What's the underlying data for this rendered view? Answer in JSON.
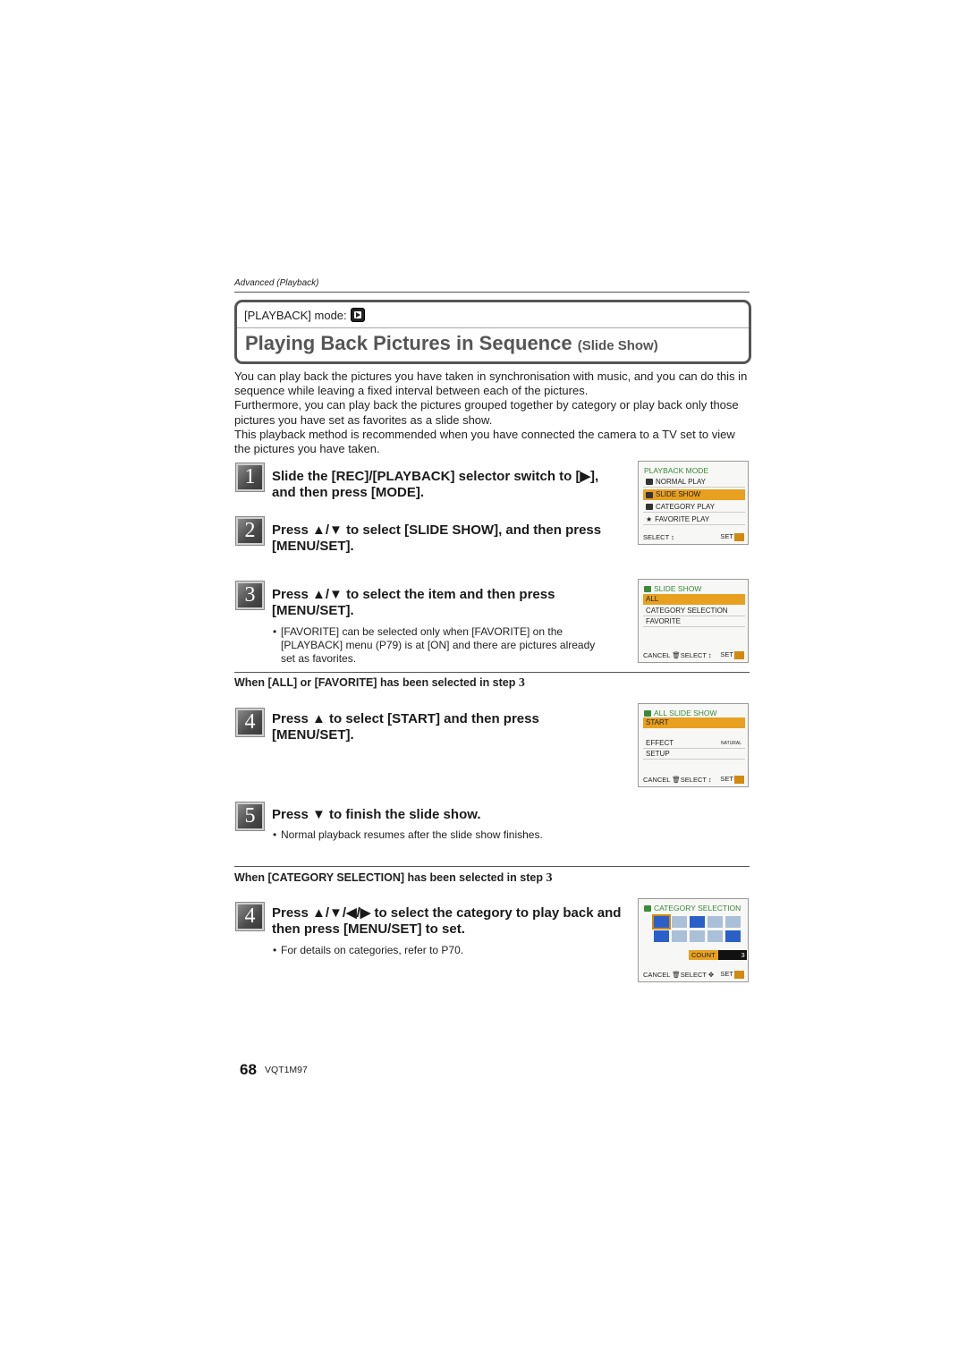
{
  "header": {
    "section_label": "Advanced (Playback)",
    "mode_label": "[PLAYBACK] mode:",
    "mode_icon": "playback-mode-icon",
    "title": "Playing Back Pictures in Sequence",
    "title_sub": "(Slide Show)"
  },
  "intro": [
    "You can play back the pictures you have taken in synchronisation with music, and you can do this in sequence while leaving a fixed interval between each of the pictures.",
    "Furthermore, you can play back the pictures grouped together by category or play back only those pictures you have set as favorites as a slide show.",
    "This playback method is recommended when you have connected the camera to a TV set to view the pictures you have taken."
  ],
  "steps": [
    {
      "number": "1",
      "text": "Slide the [REC]/[PLAYBACK] selector switch to [▶], and then press [MODE]."
    },
    {
      "number": "2",
      "text": "Press ▲/▼ to select [SLIDE SHOW], and then press [MENU/SET]."
    },
    {
      "number": "3",
      "text": "Press ▲/▼ to select the item and then press [MENU/SET].",
      "bullet": "[FAVORITE] can be selected only when [FAVORITE] on the [PLAYBACK] menu (P79) is at [ON] and there are pictures already set as favorites."
    }
  ],
  "section_all": {
    "heading": "When [ALL] or [FAVORITE] has been selected in step",
    "heading_num": "3",
    "steps": [
      {
        "number": "4",
        "text": "Press ▲ to select [START] and then press [MENU/SET]."
      },
      {
        "number": "5",
        "text": "Press ▼ to finish the slide show.",
        "bullet": "Normal playback resumes after the slide show finishes."
      }
    ]
  },
  "section_category": {
    "heading": "When [CATEGORY SELECTION] has been selected in step",
    "heading_num": "3",
    "steps": [
      {
        "number": "4",
        "text": "Press ▲/▼/◀/▶ to select the category to play back and then press [MENU/SET] to set.",
        "bullet": "For details on categories, refer to P70."
      }
    ]
  },
  "screens": {
    "playback_mode": {
      "title": "PLAYBACK MODE",
      "items": [
        "NORMAL PLAY",
        "SLIDE SHOW",
        "CATEGORY PLAY",
        "FAVORITE PLAY"
      ],
      "selected": "SLIDE SHOW",
      "footer_left": "SELECT ↕",
      "footer_right": "SET"
    },
    "slide_show": {
      "title": "SLIDE SHOW",
      "items": [
        "ALL",
        "CATEGORY SELECTION",
        "FAVORITE"
      ],
      "selected": "ALL",
      "footer_left": "CANCEL",
      "footer_mid": "SELECT ↕",
      "footer_right": "SET"
    },
    "all_slide_show": {
      "title": "ALL SLIDE SHOW",
      "items": [
        "START",
        "EFFECT",
        "SETUP"
      ],
      "effect_value": "NATURAL",
      "selected": "START",
      "footer_left": "CANCEL",
      "footer_mid": "SELECT ↕",
      "footer_right": "SET"
    },
    "category_selection": {
      "title": "CATEGORY SELECTION",
      "count_label": "COUNT",
      "count_value": "3",
      "footer_left": "CANCEL",
      "footer_mid": "SELECT ✥",
      "footer_right": "SET"
    }
  },
  "footer": {
    "page_number": "68",
    "model_code": "VQT1M97"
  }
}
